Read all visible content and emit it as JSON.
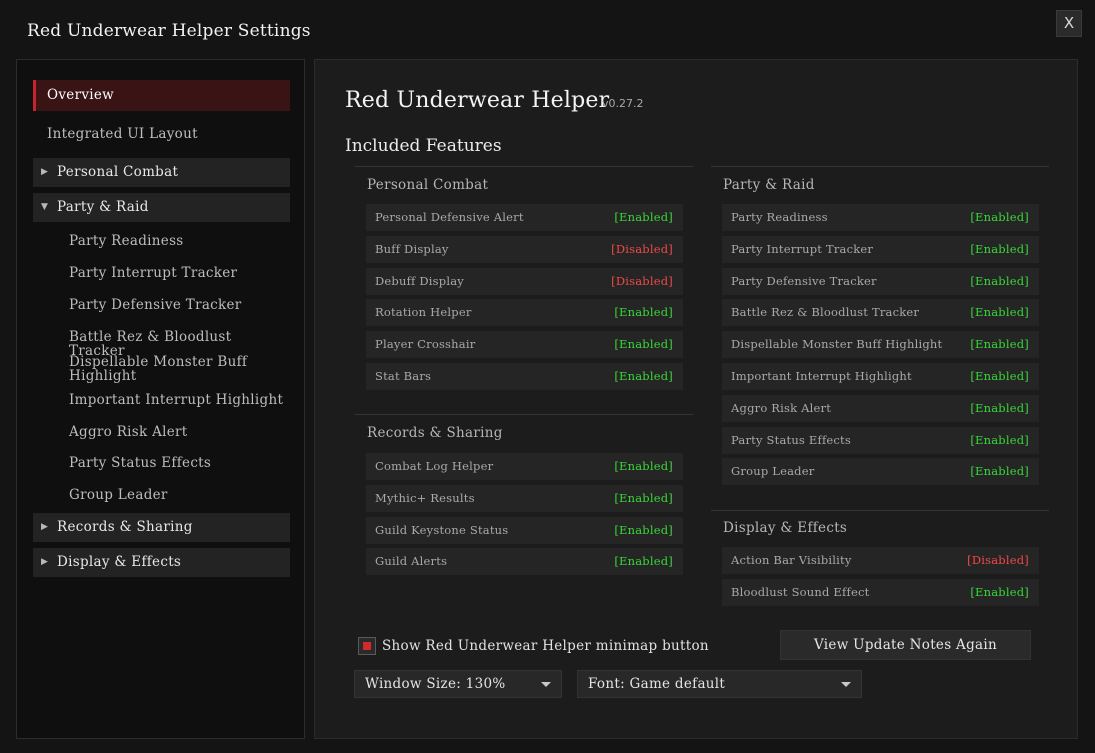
{
  "window": {
    "title": "Red Underwear Helper Settings",
    "close_label": "X"
  },
  "sidebar": {
    "overview": "Overview",
    "integrated": "Integrated UI Layout",
    "groups": {
      "personal": "Personal Combat",
      "party": "Party & Raid",
      "records": "Records & Sharing",
      "display": "Display & Effects"
    },
    "party_items": [
      "Party Readiness",
      "Party Interrupt Tracker",
      "Party Defensive Tracker",
      "Battle Rez & Bloodlust Tracker",
      "Dispellable Monster Buff Highlight",
      "Important Interrupt Highlight",
      "Aggro Risk Alert",
      "Party Status Effects",
      "Group Leader"
    ]
  },
  "main": {
    "title": "Red Underwear Helper",
    "version": "v0.27.2",
    "section_title": "Included Features",
    "status_text": {
      "enabled": "[Enabled]",
      "disabled": "[Disabled]"
    },
    "colors": {
      "enabled": "#39d739",
      "disabled": "#f04848",
      "accent": "#c4242a"
    },
    "personal_combat": {
      "heading": "Personal Combat",
      "features": [
        {
          "name": "Personal Defensive Alert",
          "status": "[Enabled]"
        },
        {
          "name": "Buff Display",
          "status": "[Disabled]"
        },
        {
          "name": "Debuff Display",
          "status": "[Disabled]"
        },
        {
          "name": "Rotation Helper",
          "status": "[Enabled]"
        },
        {
          "name": "Player Crosshair",
          "status": "[Enabled]"
        },
        {
          "name": "Stat Bars",
          "status": "[Enabled]"
        }
      ]
    },
    "records_sharing": {
      "heading": "Records & Sharing",
      "features": [
        {
          "name": "Combat Log Helper",
          "status": "[Enabled]"
        },
        {
          "name": "Mythic+ Results",
          "status": "[Enabled]"
        },
        {
          "name": "Guild Keystone Status",
          "status": "[Enabled]"
        },
        {
          "name": "Guild Alerts",
          "status": "[Enabled]"
        }
      ]
    },
    "party_raid": {
      "heading": "Party & Raid",
      "features": [
        {
          "name": "Party Readiness",
          "status": "[Enabled]"
        },
        {
          "name": "Party Interrupt Tracker",
          "status": "[Enabled]"
        },
        {
          "name": "Party Defensive Tracker",
          "status": "[Enabled]"
        },
        {
          "name": "Battle Rez & Bloodlust Tracker",
          "status": "[Enabled]"
        },
        {
          "name": "Dispellable Monster Buff Highlight",
          "status": "[Enabled]"
        },
        {
          "name": "Important Interrupt Highlight",
          "status": "[Enabled]"
        },
        {
          "name": "Aggro Risk Alert",
          "status": "[Enabled]"
        },
        {
          "name": "Party Status Effects",
          "status": "[Enabled]"
        },
        {
          "name": "Group Leader",
          "status": "[Enabled]"
        }
      ]
    },
    "display_effects": {
      "heading": "Display & Effects",
      "features": [
        {
          "name": "Action Bar Visibility",
          "status": "[Disabled]"
        },
        {
          "name": "Bloodlust Sound Effect",
          "status": "[Enabled]"
        }
      ]
    },
    "minimap_checkbox": {
      "label": "Show Red Underwear Helper minimap button",
      "checked": true
    },
    "update_notes_button": "View Update Notes Again",
    "window_size_dropdown": "Window Size: 130%",
    "font_dropdown": "Font: Game default"
  }
}
